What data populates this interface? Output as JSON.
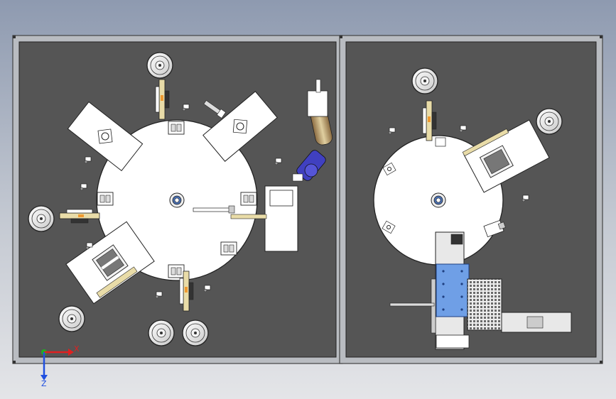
{
  "triad": {
    "x_label": "X",
    "z_label": "Z",
    "x_color": "#e02020",
    "z_color": "#2050e0",
    "origin_color": "#20b020"
  },
  "colors": {
    "frame": "#b9bcc1",
    "panel": "#555555",
    "table": "#ffffff",
    "outline": "#222222",
    "wood": "#e9dca8",
    "robot": "#4040c0",
    "pallet": "#6f9fe6",
    "tray": "#d5d5d5"
  }
}
